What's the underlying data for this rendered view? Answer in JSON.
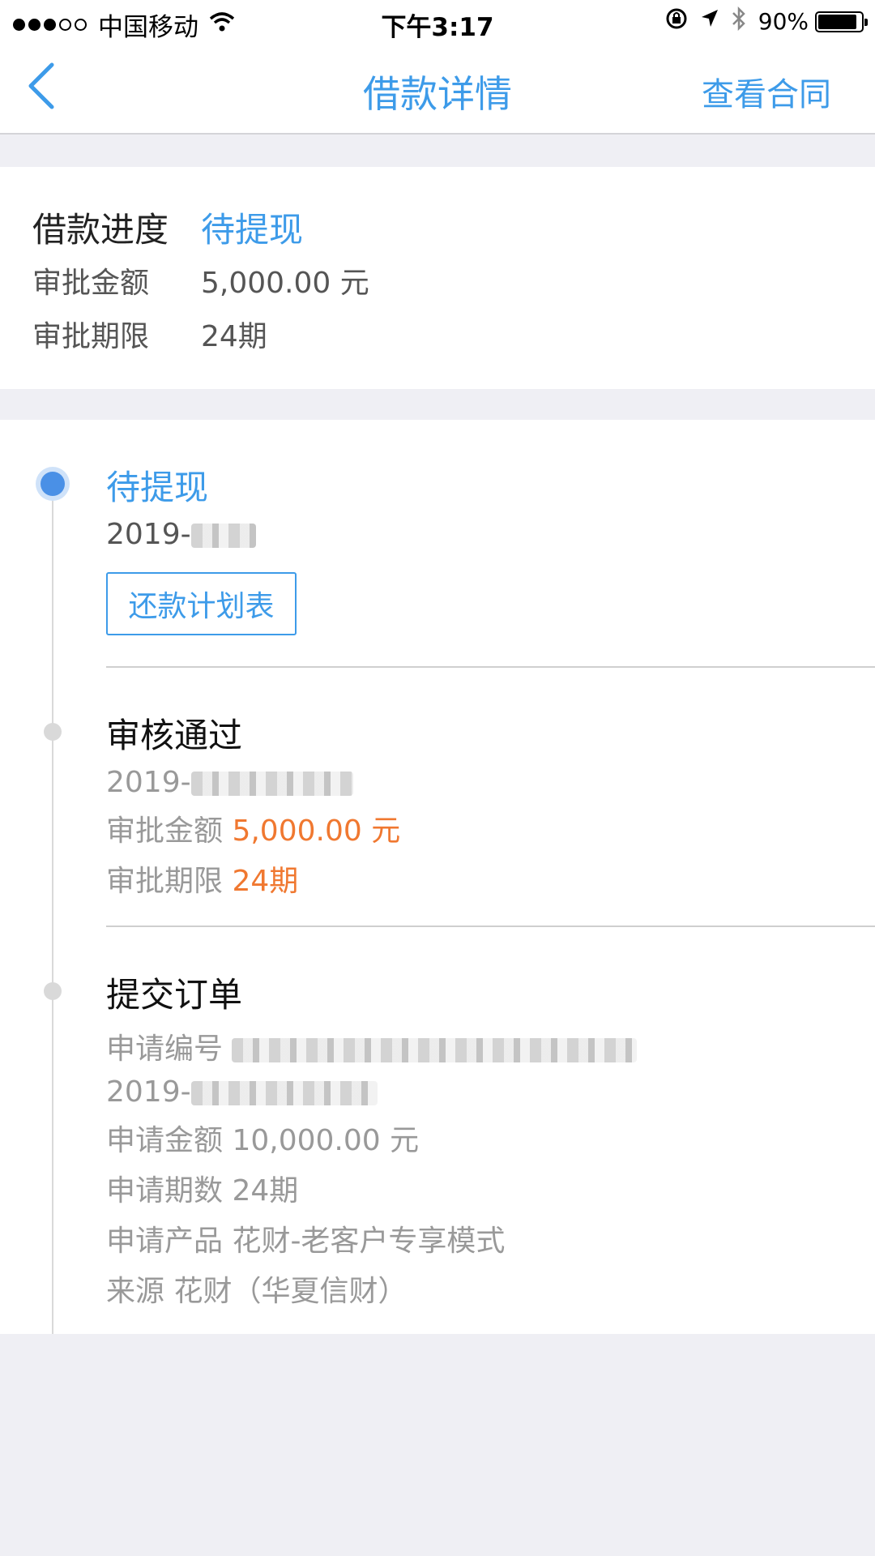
{
  "status_bar": {
    "carrier": "中国移动",
    "time": "下午3:17",
    "battery": "90%",
    "battery_level": 0.9
  },
  "nav": {
    "title": "借款详情",
    "contract_link": "查看合同"
  },
  "summary": {
    "progress_label": "借款进度",
    "progress_value": "待提现",
    "amount_label": "审批金额",
    "amount_value": "5,000.00 元",
    "term_label": "审批期限",
    "term_value": "24期"
  },
  "timeline": {
    "step1": {
      "title": "待提现",
      "date_prefix": "2019-",
      "plan_button": "还款计划表"
    },
    "step2": {
      "title": "审核通过",
      "date_prefix": "2019-",
      "amount_label": "审批金额 ",
      "amount_value": "5,000.00 元",
      "term_label": "审批期限 ",
      "term_value": "24期"
    },
    "step3": {
      "title": "提交订单",
      "app_no_label": "申请编号 ",
      "date_prefix": "2019-",
      "amount": "申请金额 10,000.00 元",
      "term": "申请期数 24期",
      "product": "申请产品 花财-老客户专享模式",
      "source": "来源 花财（华夏信财）"
    }
  },
  "colors": {
    "accent": "#3d9be9",
    "highlight": "#f07830",
    "background": "#efeff4"
  }
}
